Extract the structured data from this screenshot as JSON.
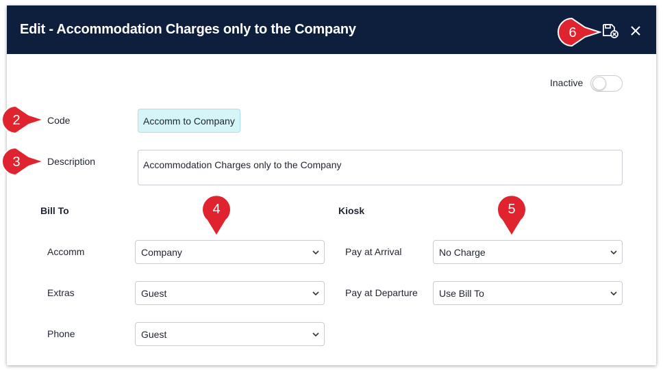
{
  "dialog": {
    "title": "Edit - Accommodation Charges only to the Company",
    "save_icon": "save-cancel-icon",
    "close_icon": "close-icon"
  },
  "inactive": {
    "label": "Inactive",
    "checked": false
  },
  "form": {
    "code_label": "Code",
    "code_value": "Accomm to Company",
    "description_label": "Description",
    "description_value": "Accommodation Charges only to the Company"
  },
  "bill_to": {
    "heading": "Bill To",
    "rows": [
      {
        "label": "Accomm",
        "value": "Company"
      },
      {
        "label": "Extras",
        "value": "Guest"
      },
      {
        "label": "Phone",
        "value": "Guest"
      }
    ]
  },
  "kiosk": {
    "heading": "Kiosk",
    "rows": [
      {
        "label": "Pay at Arrival",
        "value": "No Charge"
      },
      {
        "label": "Pay at Departure",
        "value": "Use Bill To"
      }
    ]
  },
  "callouts": {
    "color": "#e0242f",
    "items": [
      "2",
      "3",
      "4",
      "5",
      "6"
    ]
  }
}
